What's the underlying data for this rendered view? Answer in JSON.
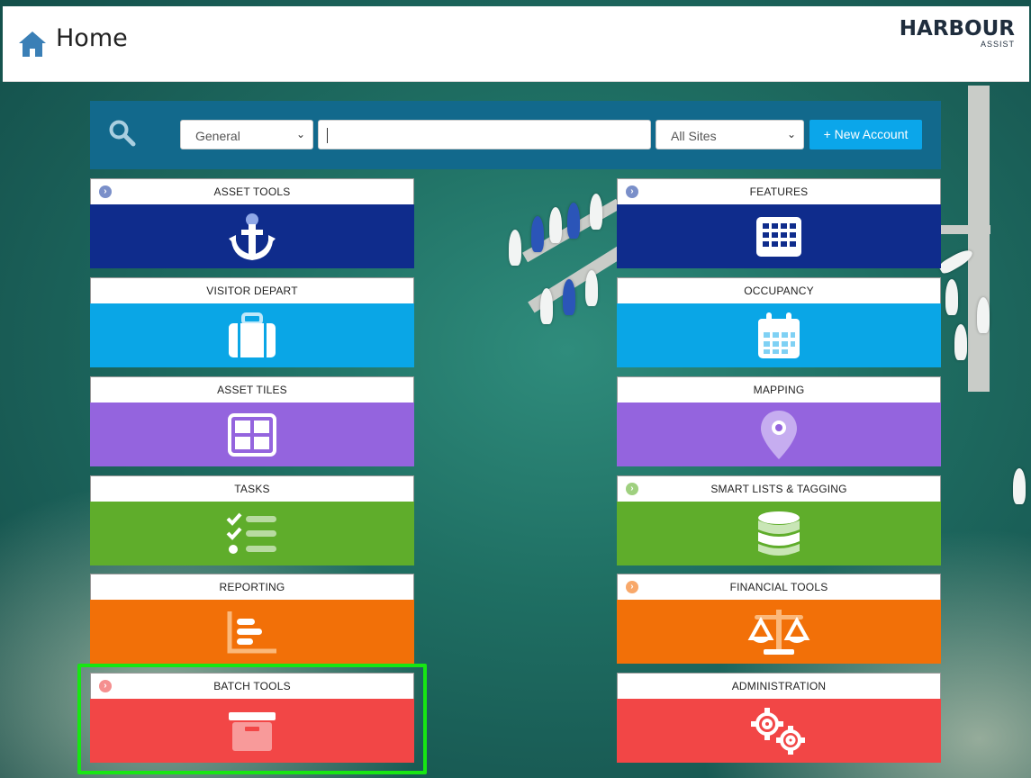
{
  "header": {
    "title": "Home",
    "logo_main_1": "H",
    "logo_main_2": "A",
    "logo_main_3": "RBOUR",
    "logo_sub": "ASSIST"
  },
  "search": {
    "category_select": "General",
    "input_value": "",
    "sites_select": "All Sites",
    "new_account_label": "New Account"
  },
  "tiles": {
    "asset_tools": {
      "label": "ASSET TOOLS",
      "color": "#0f2c8c",
      "icon": "anchor-icon"
    },
    "features": {
      "label": "FEATURES",
      "color": "#0f2c8c",
      "icon": "grid-icon"
    },
    "visitor_depart": {
      "label": "VISITOR DEPART",
      "color": "#0aa6e6",
      "icon": "suitcase-icon"
    },
    "occupancy": {
      "label": "OCCUPANCY",
      "color": "#0aa6e6",
      "icon": "calendar-icon"
    },
    "asset_tiles": {
      "label": "ASSET TILES",
      "color": "#9464de",
      "icon": "tiles-icon"
    },
    "mapping": {
      "label": "MAPPING",
      "color": "#9464de",
      "icon": "map-pin-icon"
    },
    "tasks": {
      "label": "TASKS",
      "color": "#5fad2b",
      "icon": "checklist-icon"
    },
    "smart_lists": {
      "label": "SMART LISTS & TAGGING",
      "color": "#5fad2b",
      "icon": "database-icon"
    },
    "reporting": {
      "label": "REPORTING",
      "color": "#f27008",
      "icon": "bar-chart-icon"
    },
    "financial_tools": {
      "label": "FINANCIAL TOOLS",
      "color": "#f27008",
      "icon": "scales-icon"
    },
    "batch_tools": {
      "label": "BATCH TOOLS",
      "color": "#f24646",
      "icon": "archive-box-icon"
    },
    "administration": {
      "label": "ADMINISTRATION",
      "color": "#f24646",
      "icon": "gears-icon"
    }
  },
  "highlight_color": "#17e613"
}
